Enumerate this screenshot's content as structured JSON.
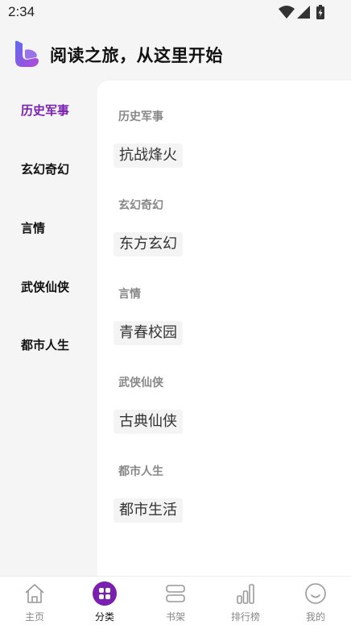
{
  "status_bar": {
    "time": "2:34"
  },
  "header": {
    "title": "阅读之旅，从这里开始"
  },
  "colors": {
    "accent": "#7a1fb0",
    "muted": "#888888"
  },
  "sidebar": {
    "items": [
      {
        "label": "历史军事",
        "active": true
      },
      {
        "label": "玄幻奇幻",
        "active": false
      },
      {
        "label": "言情",
        "active": false
      },
      {
        "label": "武侠仙侠",
        "active": false
      },
      {
        "label": "都市人生",
        "active": false
      }
    ]
  },
  "content": {
    "sections": [
      {
        "title": "历史军事",
        "tags": [
          "抗战烽火"
        ]
      },
      {
        "title": "玄幻奇幻",
        "tags": [
          "东方玄幻"
        ]
      },
      {
        "title": "言情",
        "tags": [
          "青春校园"
        ]
      },
      {
        "title": "武侠仙侠",
        "tags": [
          "古典仙侠"
        ]
      },
      {
        "title": "都市人生",
        "tags": [
          "都市生活"
        ]
      }
    ]
  },
  "bottom_nav": {
    "items": [
      {
        "label": "主页",
        "icon": "home-icon",
        "active": false
      },
      {
        "label": "分类",
        "icon": "category-icon",
        "active": true
      },
      {
        "label": "书架",
        "icon": "bookshelf-icon",
        "active": false
      },
      {
        "label": "排行榜",
        "icon": "ranking-icon",
        "active": false
      },
      {
        "label": "我的",
        "icon": "profile-icon",
        "active": false
      }
    ]
  }
}
